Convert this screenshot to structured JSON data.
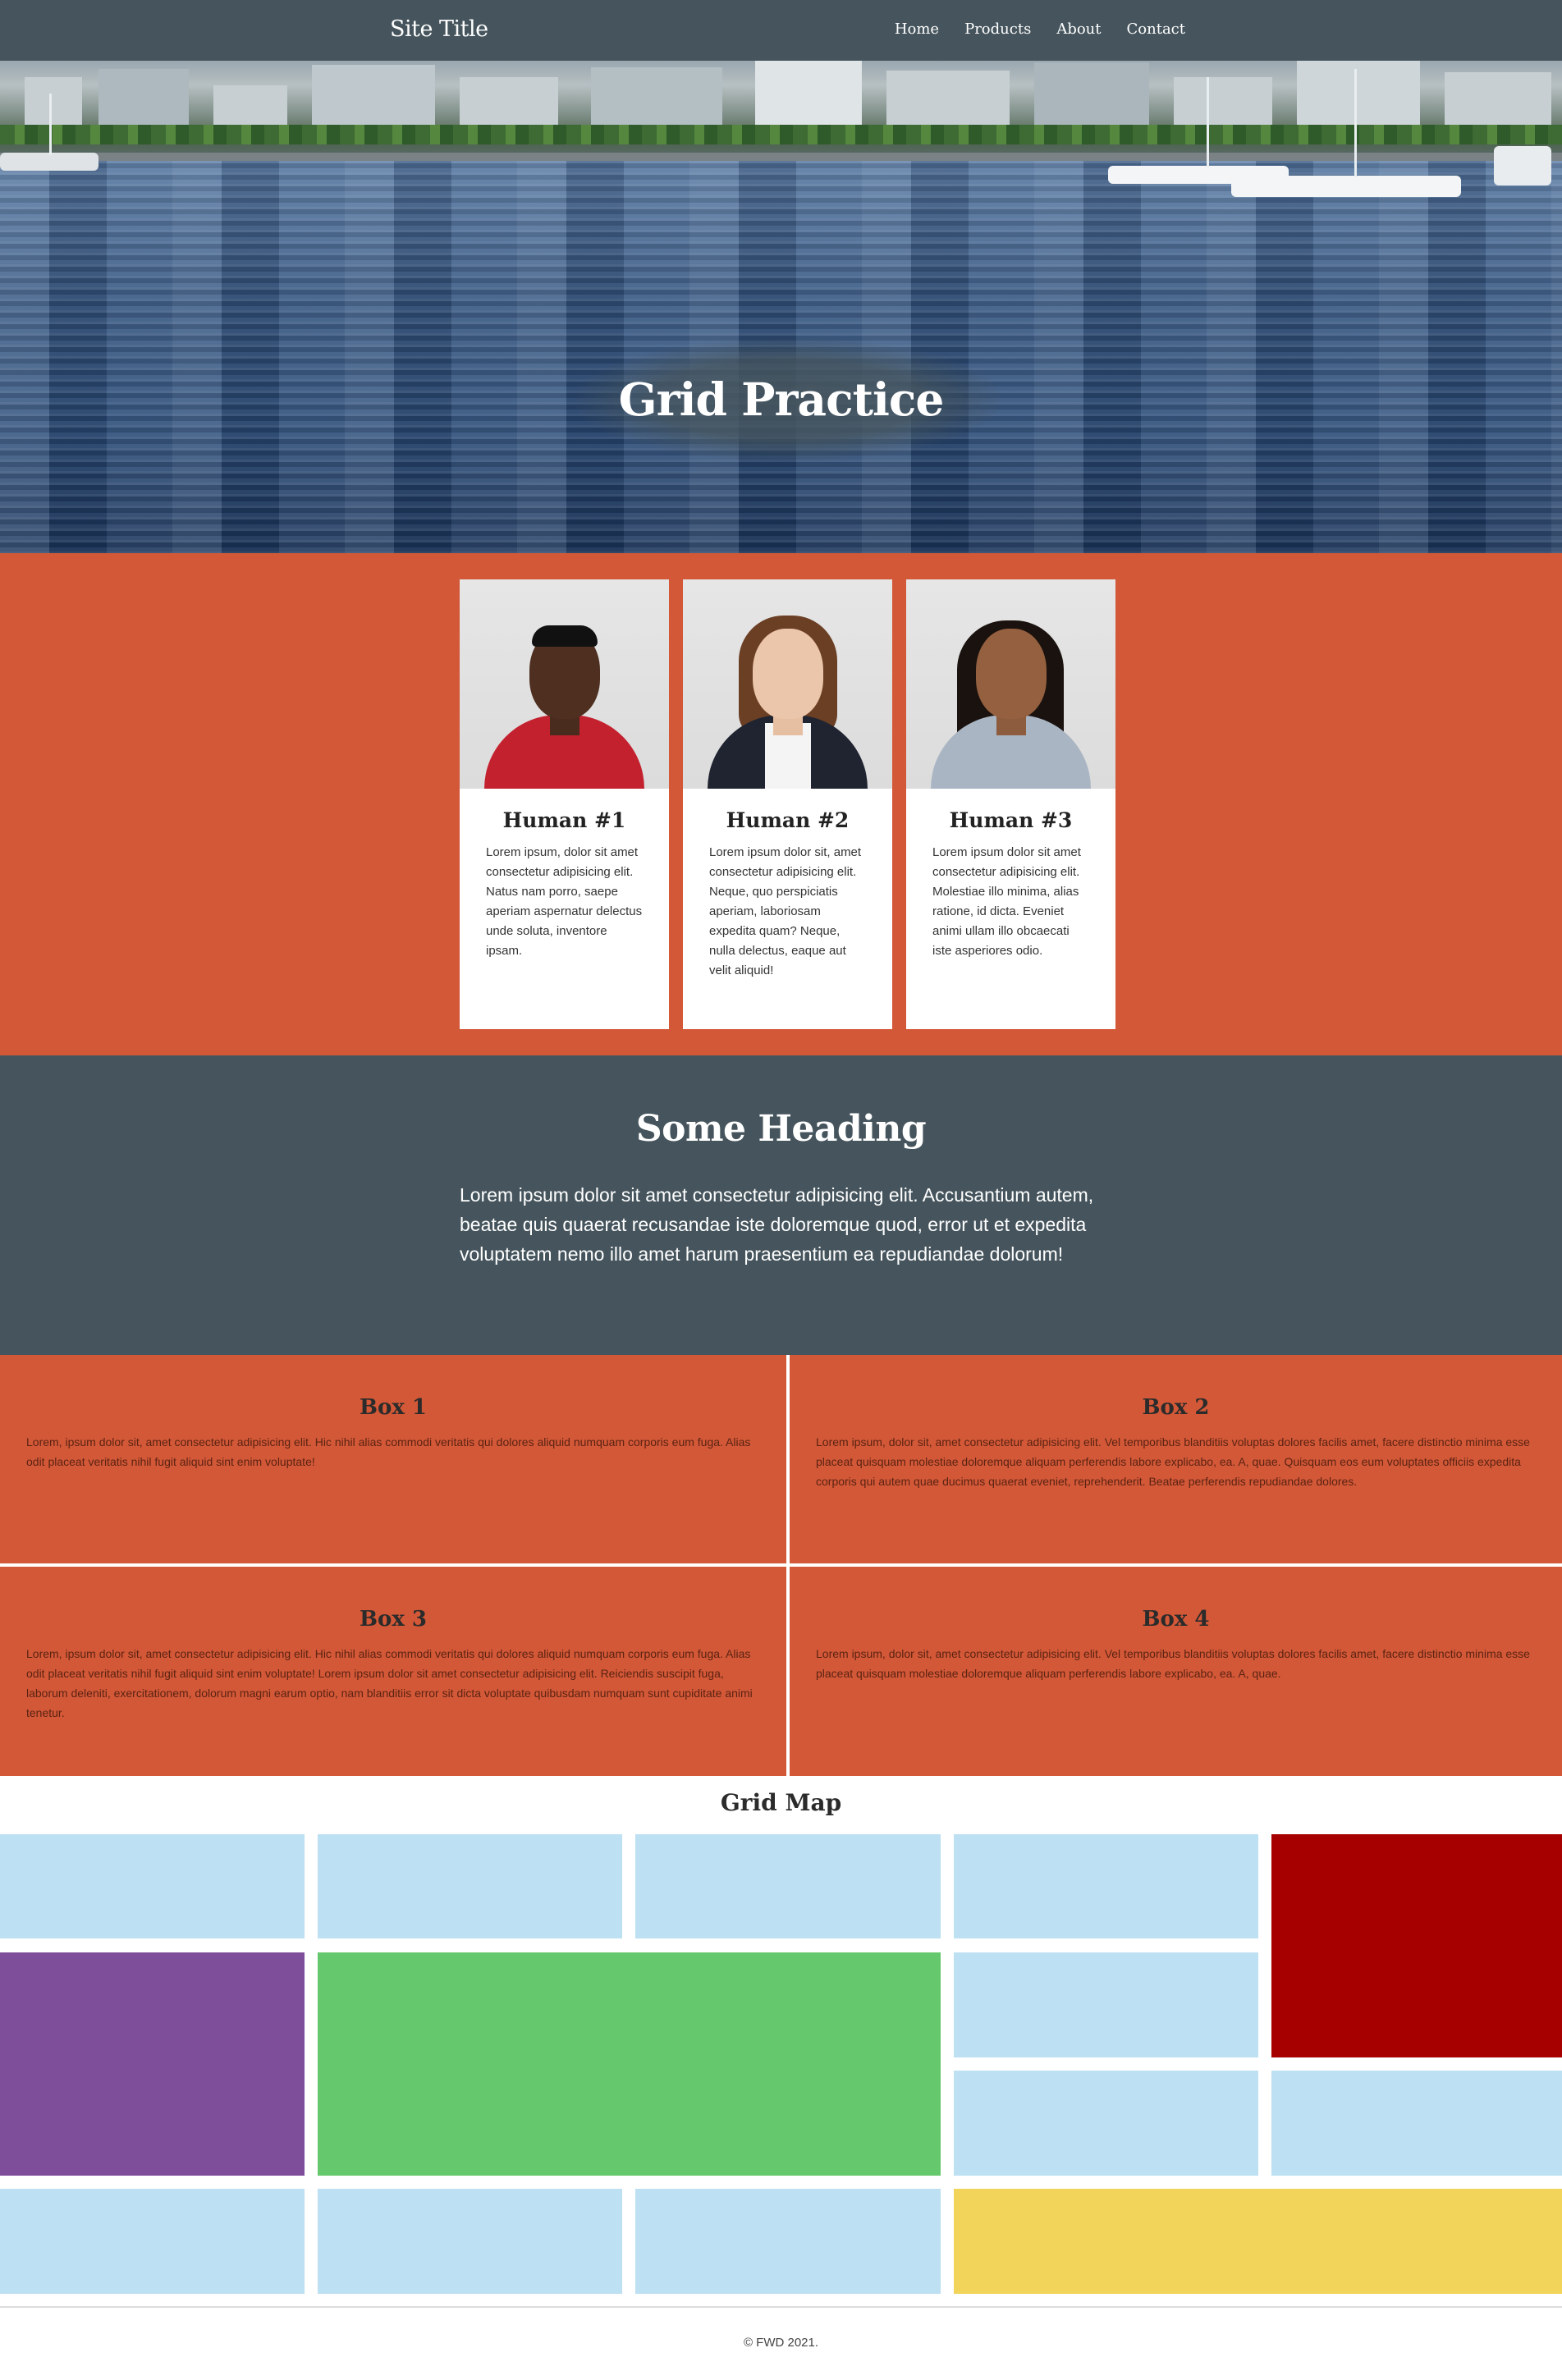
{
  "header": {
    "site_title": "Site Title",
    "nav": [
      "Home",
      "Products",
      "About",
      "Contact"
    ]
  },
  "hero": {
    "title": "Grid Practice"
  },
  "people": [
    {
      "name": "Human #1",
      "text": "Lorem ipsum, dolor sit amet consectetur adipisicing elit. Natus nam porro, saepe aperiam aspernatur delectus unde soluta, inventore ipsam."
    },
    {
      "name": "Human #2",
      "text": "Lorem ipsum dolor sit, amet consectetur adipisicing elit. Neque, quo perspiciatis aperiam, laboriosam expedita quam? Neque, nulla delectus, eaque aut velit aliquid!"
    },
    {
      "name": "Human #3",
      "text": "Lorem ipsum dolor sit amet consectetur adipisicing elit. Molestiae illo minima, alias ratione, id dicta. Eveniet animi ullam illo obcaecati iste asperiores odio."
    }
  ],
  "feature": {
    "heading": "Some Heading",
    "text": "Lorem ipsum dolor sit amet consectetur adipisicing elit. Accusantium autem, beatae quis quaerat recusandae iste doloremque quod, error ut et expedita voluptatem nemo illo amet harum praesentium ea repudiandae dolorum!"
  },
  "boxes": [
    {
      "title": "Box 1",
      "text": "Lorem, ipsum dolor sit, amet consectetur adipisicing elit. Hic nihil alias commodi veritatis qui dolores aliquid numquam corporis eum fuga. Alias odit placeat veritatis nihil fugit aliquid sint enim voluptate!"
    },
    {
      "title": "Box 2",
      "text": "Lorem ipsum, dolor sit, amet consectetur adipisicing elit. Vel temporibus blanditiis voluptas dolores facilis amet, facere distinctio minima esse placeat quisquam molestiae doloremque aliquam perferendis labore explicabo, ea. A, quae. Quisquam eos eum voluptates officiis expedita corporis qui autem quae ducimus quaerat eveniet, reprehenderit. Beatae perferendis repudiandae dolores."
    },
    {
      "title": "Box 3",
      "text": "Lorem, ipsum dolor sit, amet consectetur adipisicing elit. Hic nihil alias commodi veritatis qui dolores aliquid numquam corporis eum fuga. Alias odit placeat veritatis nihil fugit aliquid sint enim voluptate! Lorem ipsum dolor sit amet consectetur adipisicing elit. Reiciendis suscipit fuga, laborum deleniti, exercitationem, dolorum magni earum optio, nam blanditiis error sit dicta voluptate quibusdam numquam sunt cupiditate animi tenetur."
    },
    {
      "title": "Box 4",
      "text": "Lorem ipsum, dolor sit, amet consectetur adipisicing elit. Vel temporibus blanditiis voluptas dolores facilis amet, facere distinctio minima esse placeat quisquam molestiae doloremque aliquam perferendis labore explicabo, ea. A, quae."
    }
  ],
  "grid_map": {
    "title": "Grid Map",
    "colors": {
      "blue": "#bde0f2",
      "red": "#a60000",
      "purple": "#7f4e9a",
      "green": "#66c86c",
      "yellow": "#f2d45a"
    }
  },
  "footer": {
    "text": "© FWD 2021."
  },
  "colors": {
    "header_bg": "#46555d",
    "accent": "#d35837"
  }
}
